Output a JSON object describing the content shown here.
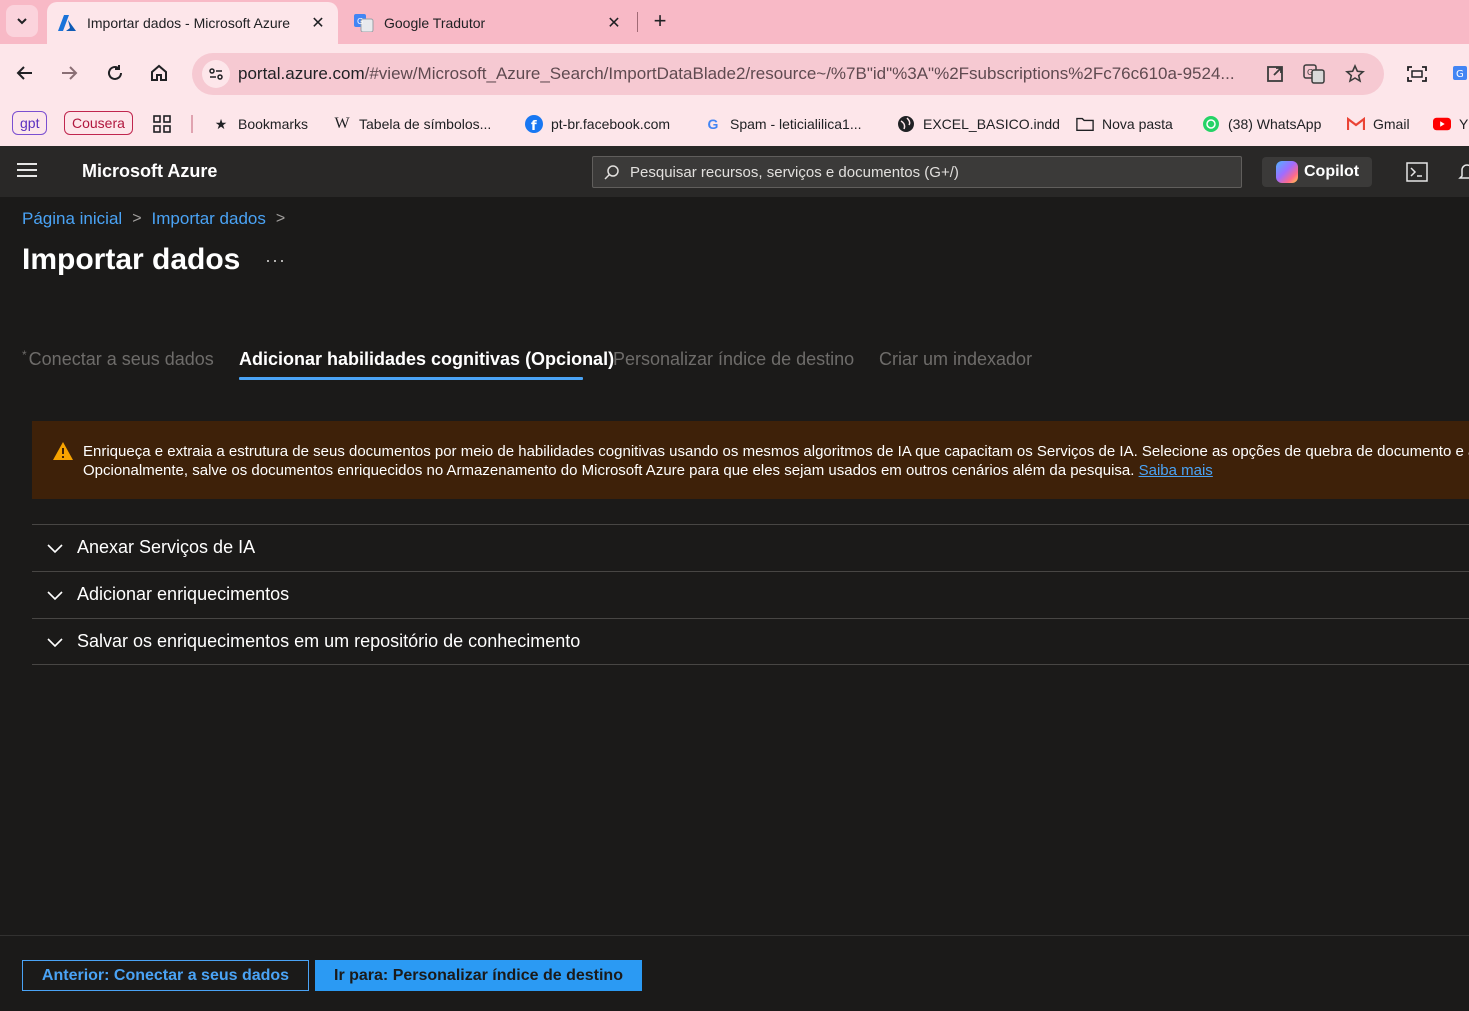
{
  "browser": {
    "tabs": [
      {
        "title": "Importar dados - Microsoft Azure",
        "active": true,
        "icon": "azure-logo-icon"
      },
      {
        "title": "Google Tradutor",
        "active": false,
        "icon": "google-translate-icon"
      }
    ],
    "url_host": "portal.azure.com",
    "url_path": "/#view/Microsoft_Azure_Search/ImportDataBlade2/resource~/%7B\"id\"%3A\"%2Fsubscriptions%2Fc76c610a-9524...",
    "bookmarks": {
      "chip1": "gpt",
      "chip2": "Cousera",
      "items": [
        "Bookmarks",
        "Tabela de símbolos...",
        "pt-br.facebook.com",
        "Spam - leticialilica1...",
        "EXCEL_BASICO.indd",
        "Nova pasta",
        "(38) WhatsApp",
        "Gmail",
        "Y"
      ]
    }
  },
  "azure": {
    "brand": "Microsoft Azure",
    "search_placeholder": "Pesquisar recursos, serviços e documentos (G+/)",
    "copilot": "Copilot"
  },
  "breadcrumb": [
    "Página inicial",
    "Importar dados"
  ],
  "page_title": "Importar dados",
  "more": "···",
  "steps": [
    {
      "label": "Conectar a seus dados",
      "required": true,
      "active": false
    },
    {
      "label": "Adicionar habilidades cognitivas (Opcional)",
      "active": true
    },
    {
      "label": "Personalizar índice de destino",
      "active": false
    },
    {
      "label": "Criar um indexador",
      "active": false
    }
  ],
  "warning": {
    "line1": "Enriqueça e extraia a estrutura de seus documentos por meio de habilidades cognitivas usando os mesmos algoritmos de IA que capacitam os Serviços de IA. Selecione as opções de quebra de documento e as h",
    "line2": "Opcionalmente, salve os documentos enriquecidos no Armazenamento do Microsoft Azure para que eles sejam usados em outros cenários além da pesquisa.",
    "link": "Saiba mais"
  },
  "accordions": [
    "Anexar Serviços de IA",
    "Adicionar enriquecimentos",
    "Salvar os enriquecimentos em um repositório de conhecimento"
  ],
  "footer": {
    "prev": "Anterior: Conectar a seus dados",
    "next": "Ir para: Personalizar índice de destino"
  },
  "colors": {
    "accent": "#4aa3f5",
    "primary_button": "#2b9af3",
    "warning_bg": "#3e2109",
    "warning_icon": "#f7a300",
    "chrome_pink": "#f8b9c6"
  }
}
